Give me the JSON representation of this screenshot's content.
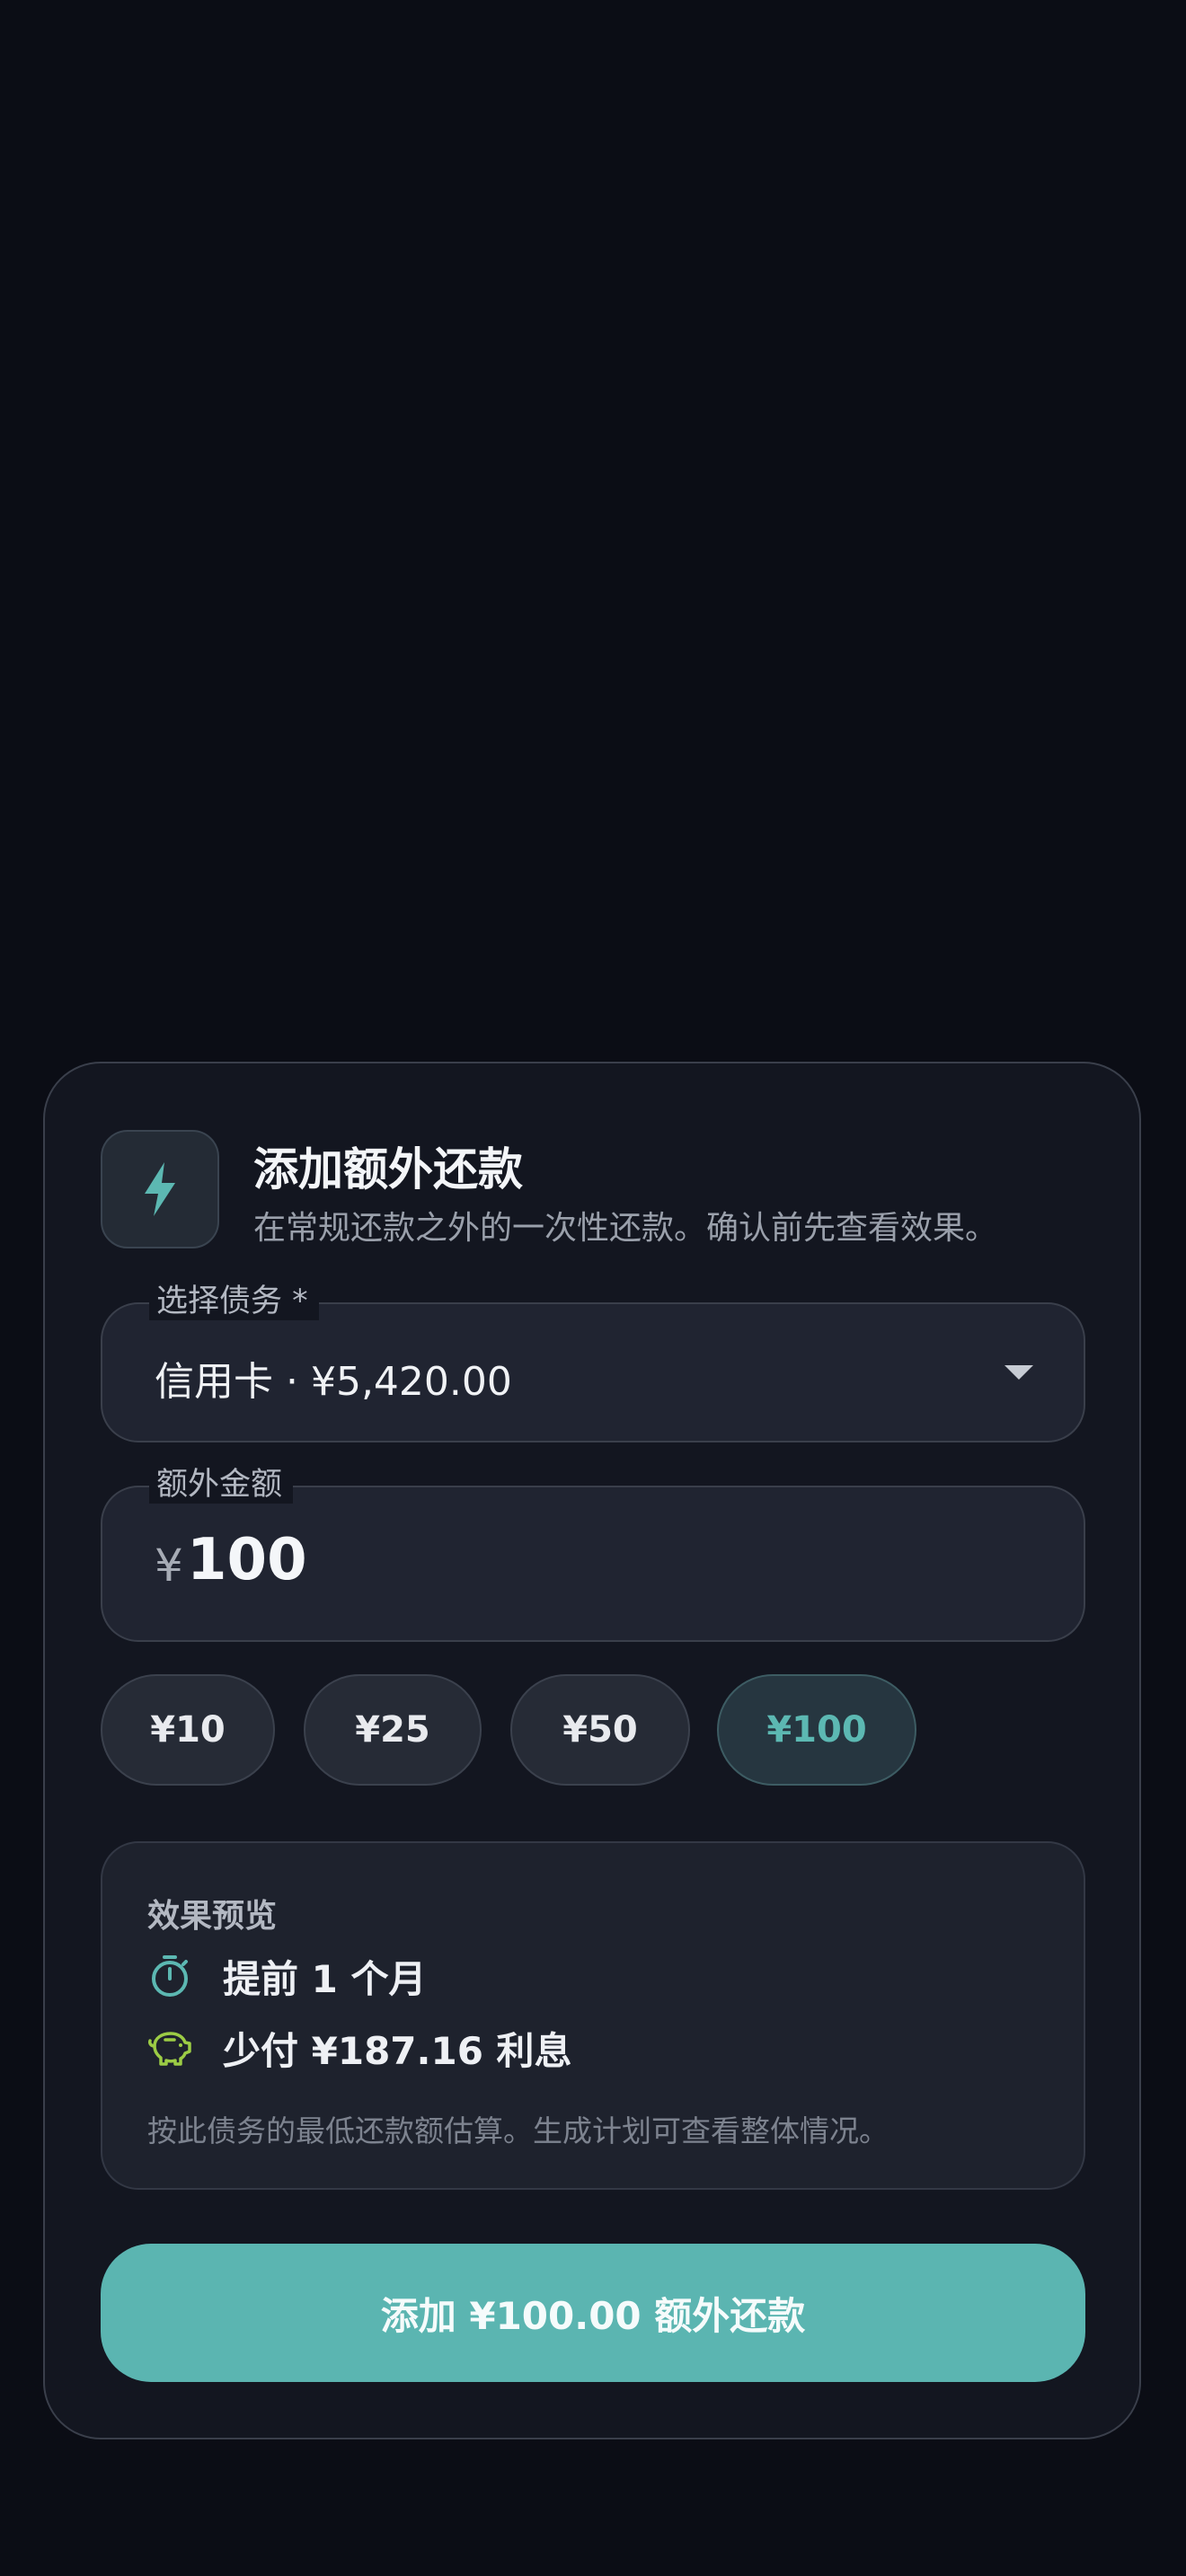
{
  "dialog": {
    "title": "添加额外还款",
    "subtitle": "在常规还款之外的一次性还款。确认前先查看效果。",
    "icon": "bolt-icon"
  },
  "debt_select": {
    "label": "选择债务 *",
    "value": "信用卡 · ¥5,420.00"
  },
  "amount_field": {
    "label": "额外金额",
    "currency": "¥",
    "value": "100"
  },
  "quick_amounts": [
    {
      "label": "¥10",
      "selected": false
    },
    {
      "label": "¥25",
      "selected": false
    },
    {
      "label": "¥50",
      "selected": false
    },
    {
      "label": "¥100",
      "selected": true
    }
  ],
  "preview": {
    "title": "效果预览",
    "items": [
      {
        "icon": "timer-icon",
        "text": "提前 1 个月"
      },
      {
        "icon": "piggy-bank-icon",
        "text": "少付 ¥187.16 利息"
      }
    ],
    "note": "按此债务的最低还款额估算。生成计划可查看整体情况。"
  },
  "submit_button": {
    "label": "添加 ¥100.00 额外还款"
  },
  "colors": {
    "background": "#0b0d15",
    "card": "#131620",
    "accent": "#5bb5b1",
    "piggy": "#9ccc45"
  }
}
